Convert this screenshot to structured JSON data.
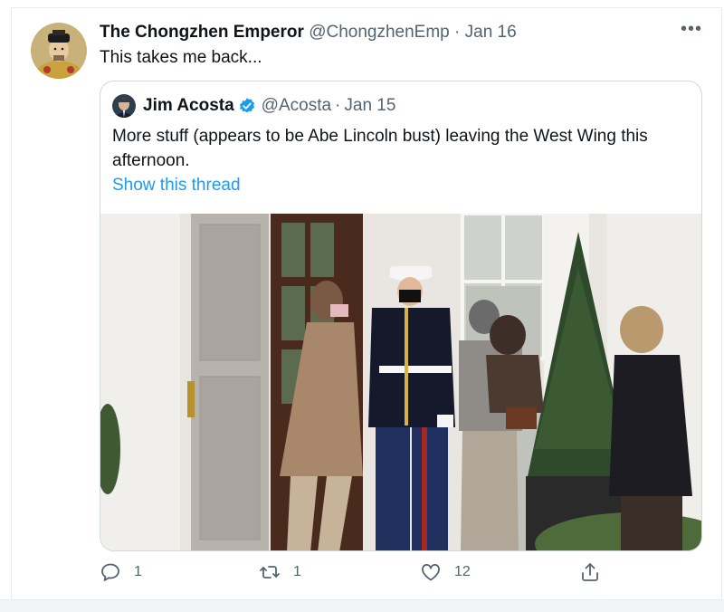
{
  "tweet": {
    "author_name": "The Chongzhen Emperor",
    "handle": "@ChongzhenEmp",
    "separator": "·",
    "date": "Jan 16",
    "text": "This takes me back...",
    "more_label": "•••"
  },
  "quoted_tweet": {
    "author_name": "Jim Acosta",
    "verified": true,
    "handle": "@Acosta",
    "separator": "·",
    "date": "Jan 15",
    "text": "More stuff (appears to be Abe Lincoln bust) leaving the West Wing this afternoon.",
    "show_thread_label": "Show this thread"
  },
  "actions": {
    "reply_count": "1",
    "retweet_count": "1",
    "like_count": "12",
    "icons": [
      "reply-icon",
      "retweet-icon",
      "like-icon",
      "share-icon"
    ]
  },
  "colors": {
    "link": "#1d9bf0",
    "muted": "#536471",
    "verified": "#1d9bf0",
    "border": "#cfd9de"
  }
}
